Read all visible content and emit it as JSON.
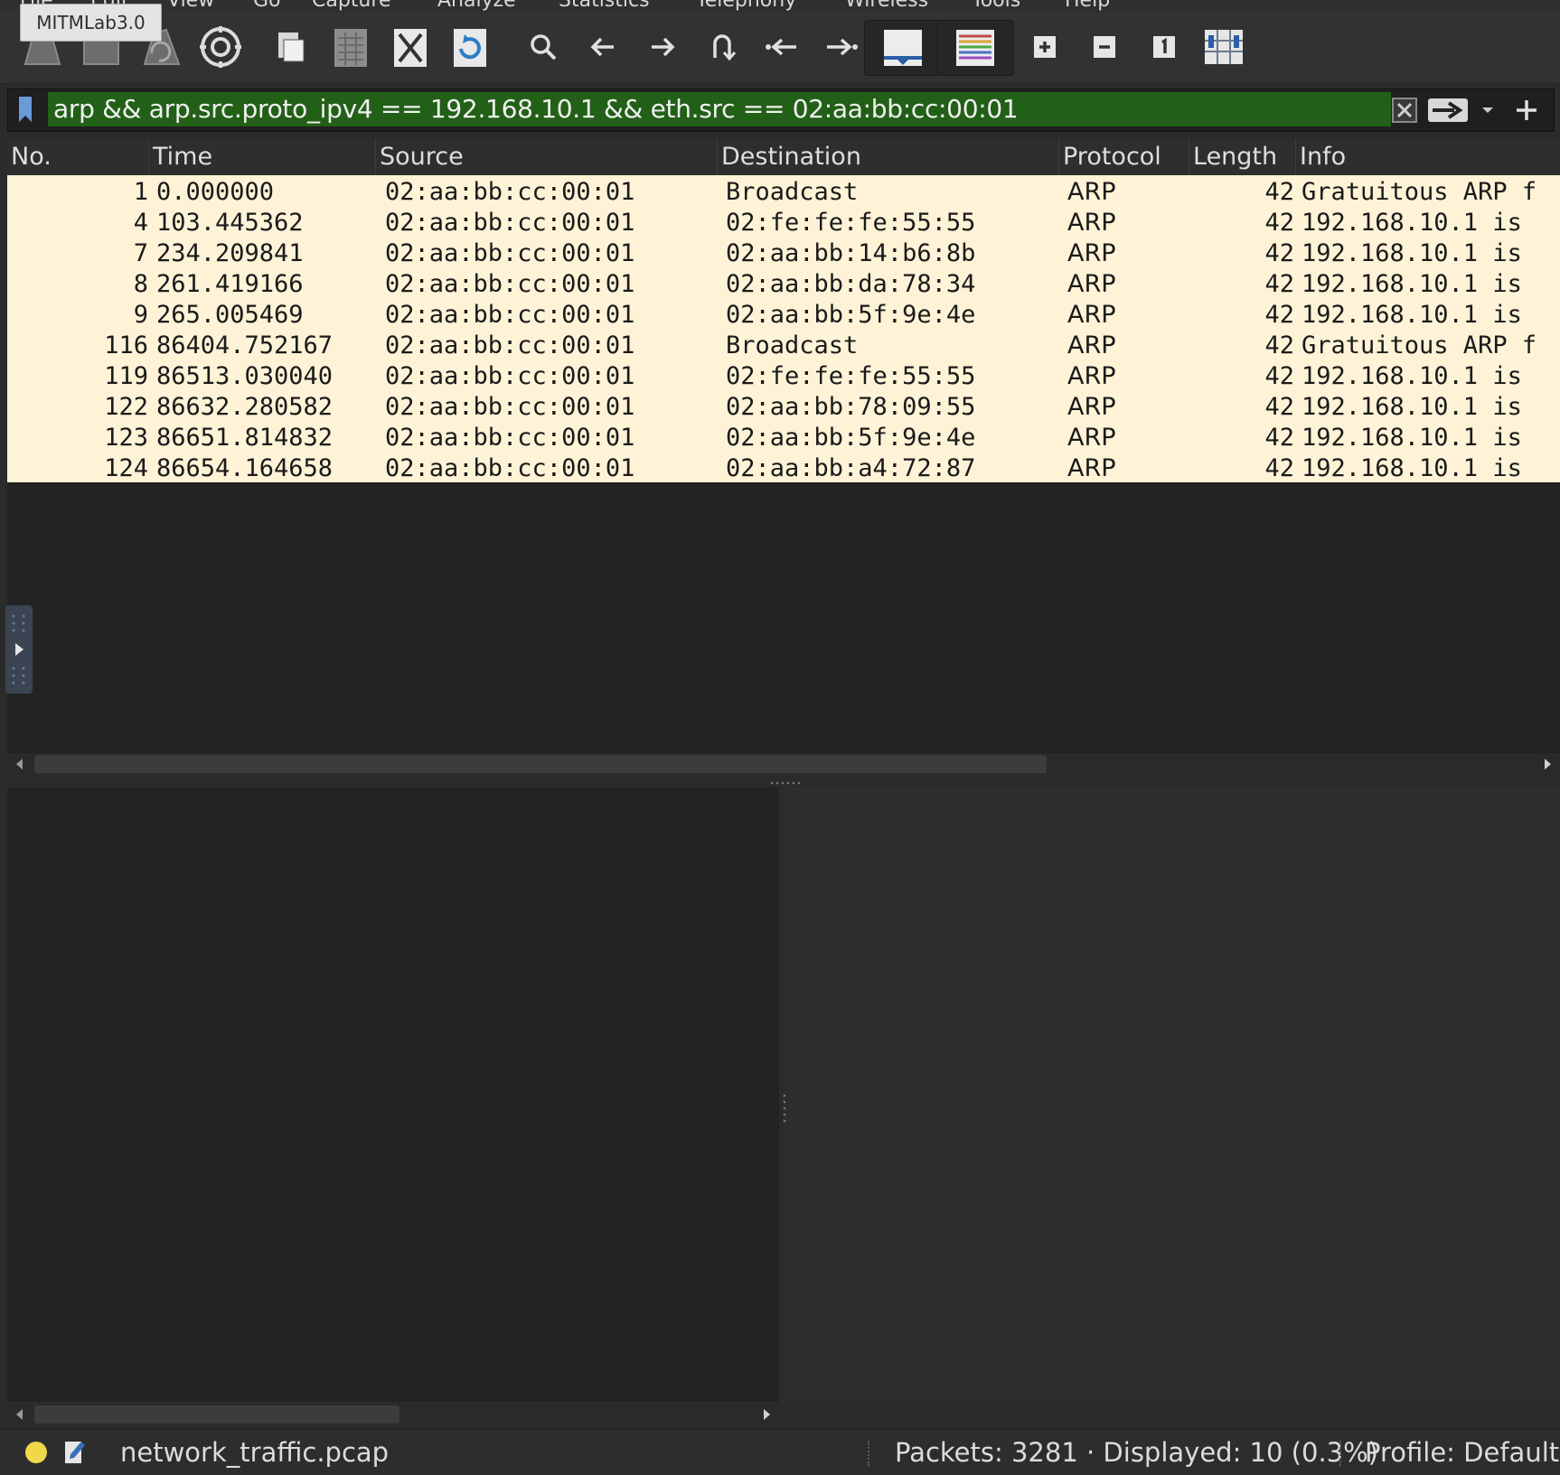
{
  "window": {
    "tooltip": "MITMLab3.0"
  },
  "menubar": {
    "items": [
      "File",
      "Edit",
      "View",
      "Go",
      "Capture",
      "Analyze",
      "Statistics",
      "Telephony",
      "Wireless",
      "Tools",
      "Help"
    ]
  },
  "toolbar": {
    "buttons": [
      {
        "name": "start-capture-icon"
      },
      {
        "name": "stop-capture-icon"
      },
      {
        "name": "restart-capture-icon"
      },
      {
        "name": "capture-options-icon"
      },
      {
        "name": "open-file-icon"
      },
      {
        "name": "save-file-icon"
      },
      {
        "name": "close-file-icon"
      },
      {
        "name": "reload-file-icon"
      },
      {
        "name": "find-packet-icon"
      },
      {
        "name": "go-back-icon"
      },
      {
        "name": "go-forward-icon"
      },
      {
        "name": "go-to-packet-icon"
      },
      {
        "name": "go-first-packet-icon"
      },
      {
        "name": "go-last-packet-icon"
      },
      {
        "name": "autoscroll-icon"
      },
      {
        "name": "colorize-icon"
      },
      {
        "name": "zoom-in-icon"
      },
      {
        "name": "zoom-out-icon"
      },
      {
        "name": "normal-size-icon"
      },
      {
        "name": "resize-columns-icon"
      }
    ]
  },
  "filter": {
    "value": "arp && arp.src.proto_ipv4 == 192.168.10.1 && eth.src == 02:aa:bb:cc:00:01",
    "valid_color": "#226017"
  },
  "packet_list": {
    "columns": [
      "No.",
      "Time",
      "Source",
      "Destination",
      "Protocol",
      "Length",
      "Info"
    ],
    "rows": [
      {
        "no": "1",
        "time": "0.000000",
        "source": "02:aa:bb:cc:00:01",
        "destination": "Broadcast",
        "protocol": "ARP",
        "length": "42",
        "info": "Gratuitous ARP f"
      },
      {
        "no": "4",
        "time": "103.445362",
        "source": "02:aa:bb:cc:00:01",
        "destination": "02:fe:fe:fe:55:55",
        "protocol": "ARP",
        "length": "42",
        "info": "192.168.10.1 is"
      },
      {
        "no": "7",
        "time": "234.209841",
        "source": "02:aa:bb:cc:00:01",
        "destination": "02:aa:bb:14:b6:8b",
        "protocol": "ARP",
        "length": "42",
        "info": "192.168.10.1 is"
      },
      {
        "no": "8",
        "time": "261.419166",
        "source": "02:aa:bb:cc:00:01",
        "destination": "02:aa:bb:da:78:34",
        "protocol": "ARP",
        "length": "42",
        "info": "192.168.10.1 is"
      },
      {
        "no": "9",
        "time": "265.005469",
        "source": "02:aa:bb:cc:00:01",
        "destination": "02:aa:bb:5f:9e:4e",
        "protocol": "ARP",
        "length": "42",
        "info": "192.168.10.1 is"
      },
      {
        "no": "116",
        "time": "86404.752167",
        "source": "02:aa:bb:cc:00:01",
        "destination": "Broadcast",
        "protocol": "ARP",
        "length": "42",
        "info": "Gratuitous ARP f"
      },
      {
        "no": "119",
        "time": "86513.030040",
        "source": "02:aa:bb:cc:00:01",
        "destination": "02:fe:fe:fe:55:55",
        "protocol": "ARP",
        "length": "42",
        "info": "192.168.10.1 is"
      },
      {
        "no": "122",
        "time": "86632.280582",
        "source": "02:aa:bb:cc:00:01",
        "destination": "02:aa:bb:78:09:55",
        "protocol": "ARP",
        "length": "42",
        "info": "192.168.10.1 is"
      },
      {
        "no": "123",
        "time": "86651.814832",
        "source": "02:aa:bb:cc:00:01",
        "destination": "02:aa:bb:5f:9e:4e",
        "protocol": "ARP",
        "length": "42",
        "info": "192.168.10.1 is"
      },
      {
        "no": "124",
        "time": "86654.164658",
        "source": "02:aa:bb:cc:00:01",
        "destination": "02:aa:bb:a4:72:87",
        "protocol": "ARP",
        "length": "42",
        "info": "192.168.10.1 is"
      }
    ],
    "row_color": "#fef3d7"
  },
  "status": {
    "file": "network_traffic.pcap",
    "packets": "Packets: 3281 · Displayed: 10 (0.3%)",
    "profile": "Profile: Default",
    "ready_color": "#f0d84a"
  }
}
